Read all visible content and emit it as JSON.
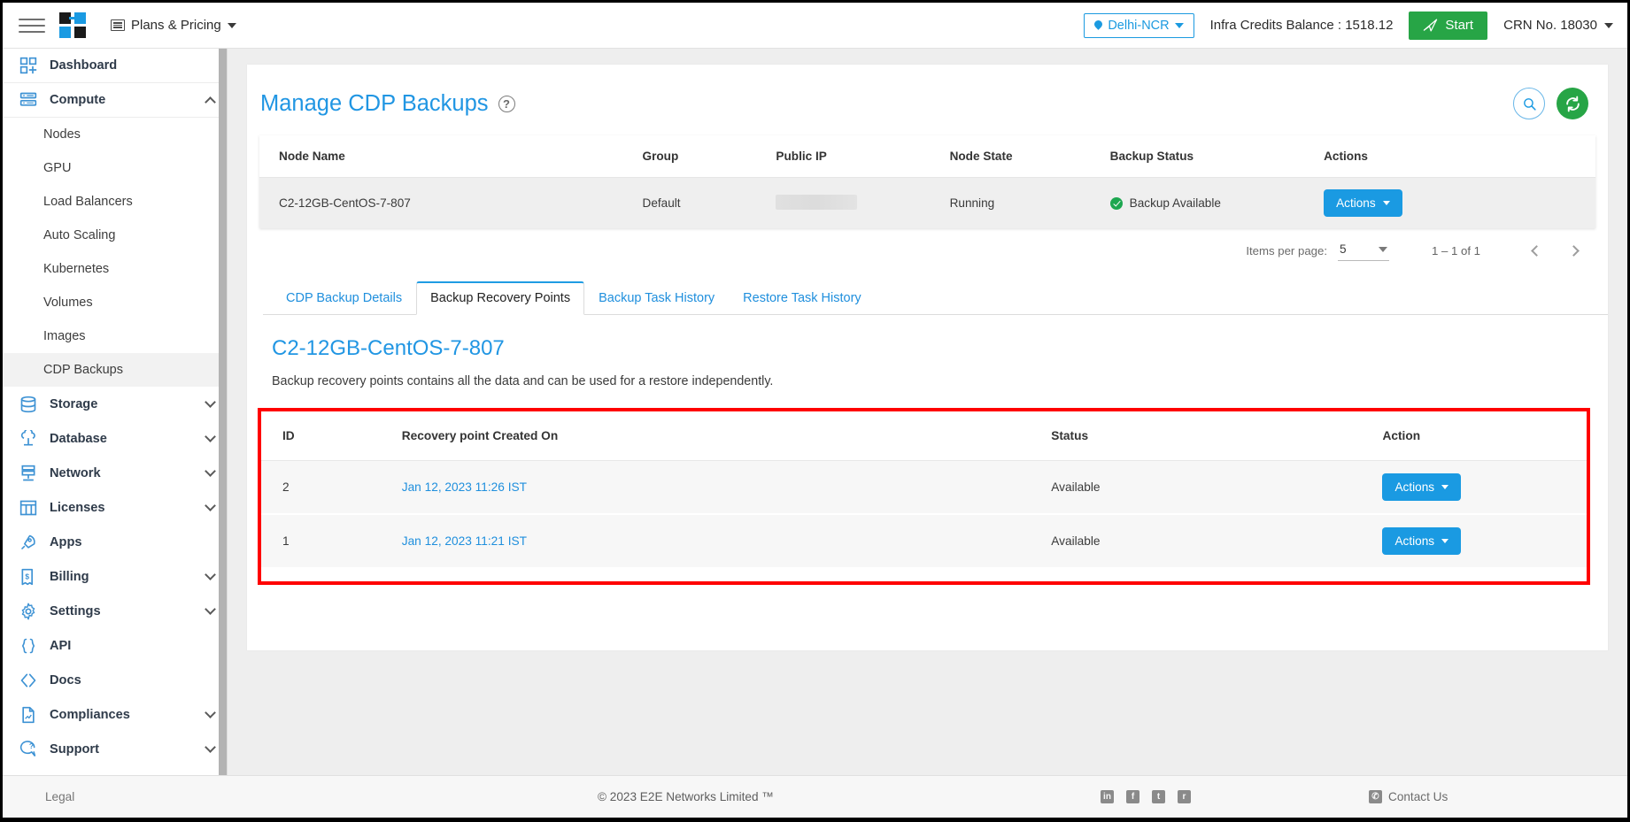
{
  "topbar": {
    "menu_icon": "hamburger-icon",
    "logo_alt": "E2E Networks",
    "plans_label": "Plans & Pricing",
    "region": "Delhi-NCR",
    "credits": "Infra Credits Balance : 1518.12",
    "start_label": "Start",
    "crn": "CRN No. 18030"
  },
  "sidebar": {
    "items": [
      {
        "label": "Dashboard",
        "icon": "dashboard-icon",
        "expandable": false
      },
      {
        "label": "Compute",
        "icon": "server-icon",
        "expandable": true,
        "expanded": true
      },
      {
        "label": "Storage",
        "icon": "database-icon",
        "expandable": true
      },
      {
        "label": "Database",
        "icon": "cloud-database-icon",
        "expandable": true
      },
      {
        "label": "Network",
        "icon": "network-icon",
        "expandable": true
      },
      {
        "label": "Licenses",
        "icon": "license-grid-icon",
        "expandable": true
      },
      {
        "label": "Apps",
        "icon": "rocket-icon",
        "expandable": false
      },
      {
        "label": "Billing",
        "icon": "invoice-icon",
        "expandable": true
      },
      {
        "label": "Settings",
        "icon": "gear-icon",
        "expandable": true
      },
      {
        "label": "API",
        "icon": "braces-icon",
        "expandable": false
      },
      {
        "label": "Docs",
        "icon": "code-brackets-icon",
        "expandable": false
      },
      {
        "label": "Compliances",
        "icon": "document-icon",
        "expandable": true
      },
      {
        "label": "Support",
        "icon": "support-chat-icon",
        "expandable": true
      }
    ],
    "compute_children": [
      {
        "label": "Nodes",
        "active": false
      },
      {
        "label": "GPU",
        "active": false
      },
      {
        "label": "Load Balancers",
        "active": false
      },
      {
        "label": "Auto Scaling",
        "active": false
      },
      {
        "label": "Kubernetes",
        "active": false
      },
      {
        "label": "Volumes",
        "active": false
      },
      {
        "label": "Images",
        "active": false
      },
      {
        "label": "CDP Backups",
        "active": true
      }
    ]
  },
  "main": {
    "page_title": "Manage CDP Backups",
    "help_icon": "help-circle-icon",
    "search_icon": "search-icon",
    "refresh_icon": "refresh-icon",
    "node_table": {
      "headers": [
        "Node Name",
        "Group",
        "Public IP",
        "Node State",
        "Backup Status",
        "Actions"
      ],
      "rows": [
        {
          "node_name": "C2-12GB-CentOS-7-807",
          "group": "Default",
          "public_ip": "",
          "node_state": "Running",
          "backup_status": "Backup Available",
          "action_label": "Actions"
        }
      ]
    },
    "paginator": {
      "items_per_page_label": "Items per page:",
      "items_per_page_value": "5",
      "range_label": "1 – 1 of 1",
      "prev_icon": "chevron-left-icon",
      "next_icon": "chevron-right-icon"
    },
    "tabs": [
      {
        "label": "CDP Backup Details",
        "active": false
      },
      {
        "label": "Backup Recovery Points",
        "active": true
      },
      {
        "label": "Backup Task History",
        "active": false
      },
      {
        "label": "Restore Task History",
        "active": false
      }
    ],
    "section": {
      "title": "C2-12GB-CentOS-7-807",
      "description": "Backup recovery points contains all the data and can be used for a restore independently."
    },
    "recovery_table": {
      "headers": [
        "ID",
        "Recovery point Created On",
        "Status",
        "Action"
      ],
      "rows": [
        {
          "id": "2",
          "created_on": "Jan 12, 2023 11:26 IST",
          "status": "Available",
          "action_label": "Actions"
        },
        {
          "id": "1",
          "created_on": "Jan 12, 2023 11:21 IST",
          "status": "Available",
          "action_label": "Actions"
        }
      ]
    }
  },
  "footer": {
    "legal": "Legal",
    "copyright": "© 2023 E2E Networks Limited ™",
    "social": [
      "in",
      "f",
      "t",
      "r"
    ],
    "contact": "Contact Us"
  },
  "colors": {
    "accent_blue": "#1a9ae2",
    "link_blue": "#1f8fdd",
    "green": "#27a546",
    "highlight_red": "#ff0000"
  }
}
